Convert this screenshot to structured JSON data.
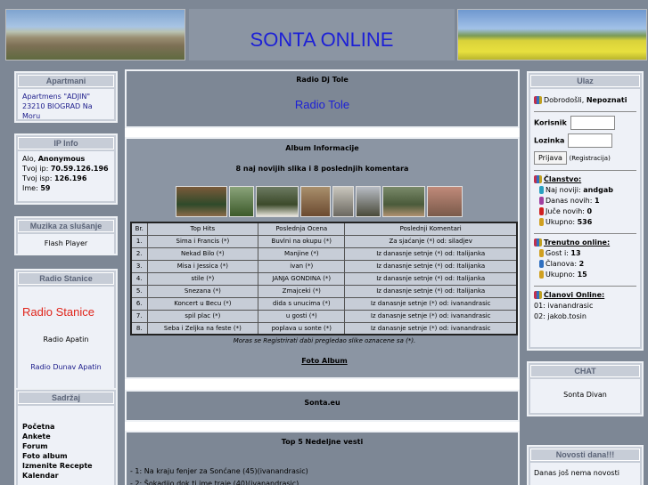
{
  "header": {
    "title": "SONTA ONLINE"
  },
  "left": {
    "apartmani": {
      "caption": "Apartmani",
      "link": "Apartmens \"ADJIN\" 23210 BIOGRAD Na Moru"
    },
    "ipinfo": {
      "caption": "IP Info",
      "l1a": "Alo, ",
      "l1b": "Anonymous",
      "l2a": "Tvoj ip: ",
      "l2b": "70.59.126.196",
      "l3a": "Tvoj isp: ",
      "l3b": "126.196",
      "l4a": "Ime: ",
      "l4b": "59"
    },
    "muzika": {
      "caption": "Muzika za slušanje",
      "text": "Flash Player"
    },
    "radio": {
      "caption": "Radio Stanice",
      "big": "Radio Stanice",
      "apatin": "Radio Apatin",
      "dunav": "Radio Dunav Apatin"
    },
    "sadrzaj": {
      "caption": "Sadržaj",
      "items": [
        "Početna",
        "Ankete",
        "Forum",
        "Foto album",
        "Izmenite Recepte",
        "Kalendar"
      ]
    }
  },
  "middle": {
    "radio_title": "Radio Dj Tole",
    "radio_link": "Radio Tole",
    "album_title": "Album Informacije",
    "album_sub": "8 naj novijih slika i 8 poslednjih komentara",
    "table_headers": [
      "Br.",
      "Top Hits",
      "Poslednja Ocena",
      "Poslednji Komentari"
    ],
    "rows": [
      [
        "1.",
        "Sima i Francis (*)",
        "Buvlni na okupu (*)",
        "Za sjaćanje (*) od: siladjev"
      ],
      [
        "2.",
        "Nekad Bilo (*)",
        "Manjine (*)",
        "Iz danasnje setnje (*) od: Italijanka"
      ],
      [
        "3.",
        "Misa i Jessica (*)",
        "ivan (*)",
        "Iz danasnje setnje (*) od: Italijanka"
      ],
      [
        "4.",
        "stile (*)",
        "JANJA GONDINA (*)",
        "Iz danasnje setnje (*) od: Italijanka"
      ],
      [
        "5.",
        "Snezana (*)",
        "Zmajceki (*)",
        "Iz danasnje setnje (*) od: Italijanka"
      ],
      [
        "6.",
        "Koncert u Becu (*)",
        "dida s unucima (*)",
        "Iz danasnje setnje (*) od: ivanandrasic"
      ],
      [
        "7.",
        "spil plac (*)",
        "u gosti (*)",
        "Iz danasnje setnje (*) od: ivanandrasic"
      ],
      [
        "8.",
        "Seba i Zeljka na feste (*)",
        "poplava u sonte (*)",
        "Iz danasnje setnje (*) od: ivanandrasic"
      ]
    ],
    "note": "Moras se Registrirati dabi pregledao slike oznacene sa (*).",
    "foto_album": "Foto Album",
    "sonta_eu": "Sonta.eu",
    "news_title": "Top 5 Nedeljne vesti",
    "news": [
      "- 1: Na kraju fenjer za Sonćane (45)(ivanandrasic)",
      "- 2: Šokadijo dok ti ime traje (40)(ivanandrasic)"
    ]
  },
  "right": {
    "ulaz": {
      "caption": "Ulaz",
      "welcome": "Dobrodošli, ",
      "guest": "Nepoznati",
      "user_label": "Korisnik",
      "pass_label": "Lozinka",
      "login_btn": "Prijava",
      "register": "(Registracija)"
    },
    "clanstvo": {
      "title": "Članstvo:",
      "l1a": "Naj noviji: ",
      "l1b": "andgab",
      "l2a": "Danas novih: ",
      "l2b": "1",
      "l3a": "Juče novih: ",
      "l3b": "0",
      "l4a": "Ukupno: ",
      "l4b": "536"
    },
    "trenutno": {
      "title": "Trenutno online:",
      "l1a": "Gost i: ",
      "l1b": "13",
      "l2a": "Članova: ",
      "l2b": "2",
      "l3a": "Ukupno: ",
      "l3b": "15"
    },
    "online": {
      "title": "Članovi Online:",
      "items": [
        "01: ivanandrasic",
        "02: jakob.tosin"
      ]
    },
    "chat": {
      "caption": "CHAT",
      "text": "Sonta Divan"
    },
    "novosti": {
      "caption": "Novosti dana!!!",
      "text": "Danas još nema novosti"
    }
  },
  "colors": {
    "title": "#1d20d6",
    "frame": "#7d8795",
    "panel": "#c7cdd7",
    "radio_red": "#e0251b"
  },
  "icons": {
    "users": "users-icon",
    "user": "user-icon"
  }
}
